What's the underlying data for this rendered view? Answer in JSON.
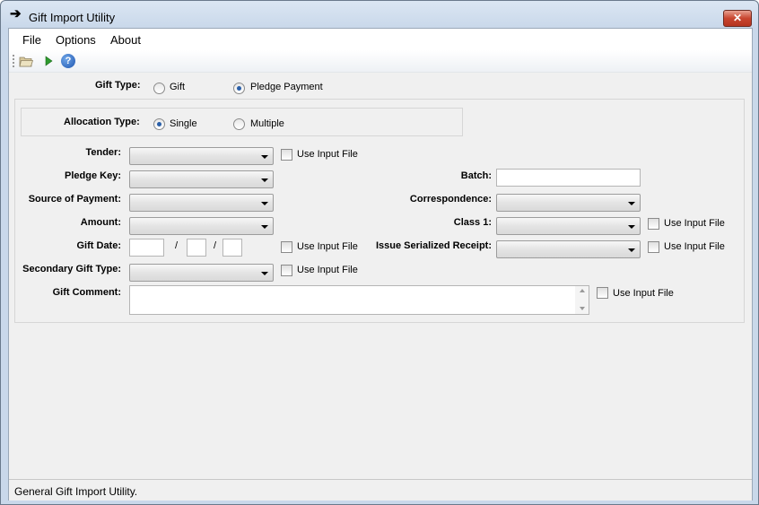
{
  "window": {
    "title": "Gift Import Utility",
    "close_glyph": "✕",
    "title_icon": "arrow-right-icon"
  },
  "menu": [
    "File",
    "Options",
    "About"
  ],
  "toolbar": {
    "icons": [
      "open-folder-icon",
      "run-icon",
      "help-icon"
    ],
    "help_glyph": "?"
  },
  "gift_type": {
    "label": "Gift Type:",
    "options": [
      "Gift",
      "Pledge Payment"
    ],
    "selected": "Pledge Payment"
  },
  "allocation_type": {
    "label": "Allocation Type:",
    "options": [
      "Single",
      "Multiple"
    ],
    "selected": "Single"
  },
  "fields": {
    "tender": "Tender:",
    "pledge_key": "Pledge Key:",
    "source_of_payment": "Source of Payment:",
    "amount": "Amount:",
    "gift_date": "Gift Date:",
    "secondary_gift_type": "Secondary Gift Type:",
    "gift_comment": "Gift Comment:",
    "batch": "Batch:",
    "correspondence": "Correspondence:",
    "class1": "Class 1:",
    "issue_serialized_receipt": "Issue Serialized Receipt:"
  },
  "date_separator": "/",
  "use_input_file": "Use Input File",
  "status": "General Gift Import Utility.",
  "colors": {
    "accent": "#2a5fa8",
    "close": "#c8452f",
    "run_icon": "#2e9a2e"
  }
}
